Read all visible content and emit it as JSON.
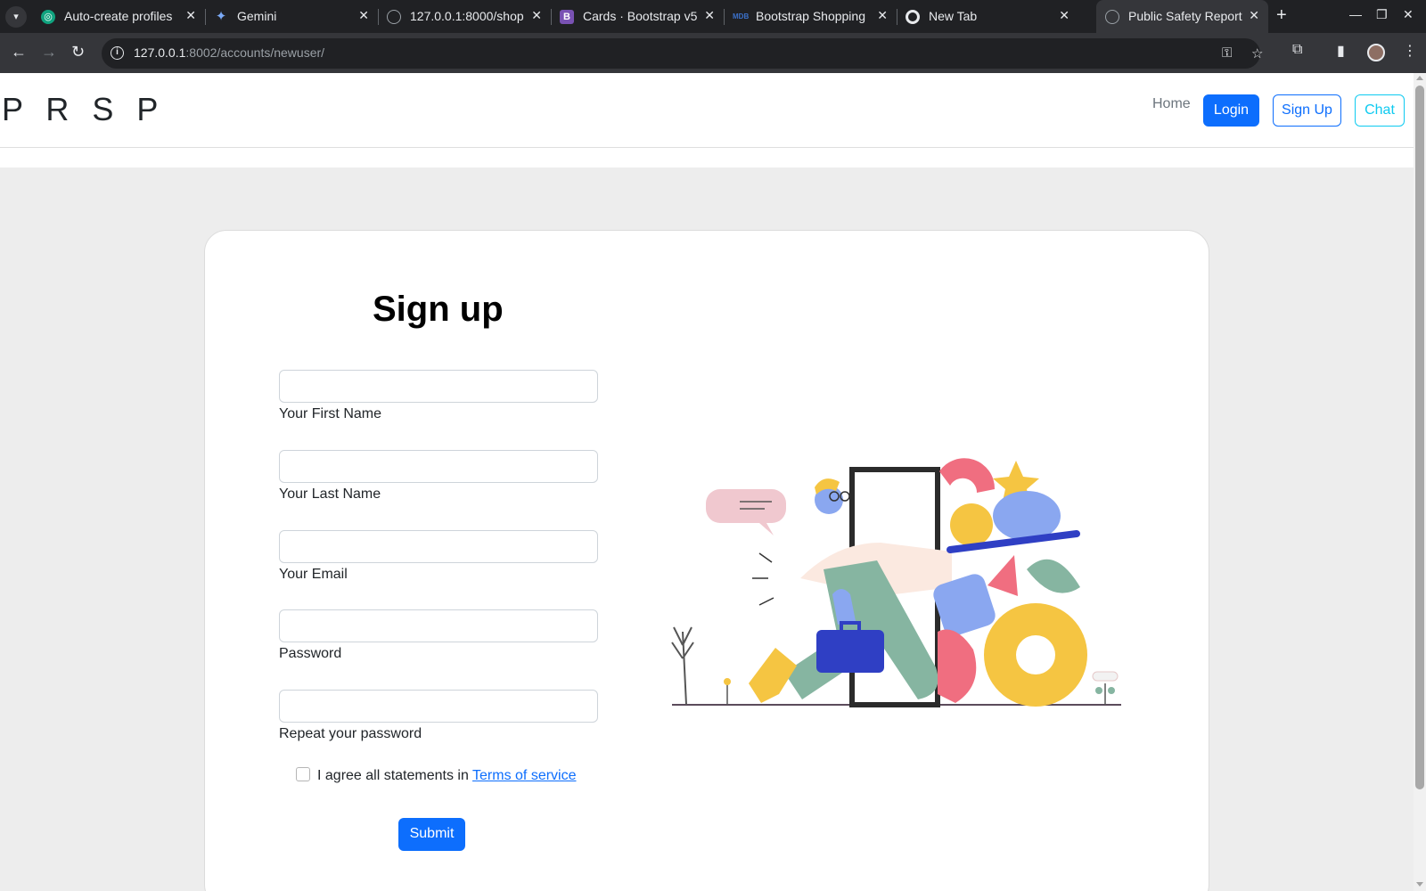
{
  "browser": {
    "tabs": [
      {
        "title": "Auto-create profiles",
        "favicon": "chatgpt-icon",
        "active": false
      },
      {
        "title": "Gemini",
        "favicon": "gemini-sparkle-icon",
        "active": false
      },
      {
        "title": "127.0.0.1:8000/shop",
        "favicon": "globe-icon",
        "active": false
      },
      {
        "title": "Cards · Bootstrap v5",
        "favicon": "bootstrap-icon",
        "active": false
      },
      {
        "title": "Bootstrap Shopping",
        "favicon": "mdb-icon",
        "active": false
      },
      {
        "title": "New Tab",
        "favicon": "chrome-icon",
        "active": false
      },
      {
        "title": "Public Safety Report",
        "favicon": "globe-icon",
        "active": true
      }
    ],
    "url_host": "127.0.0.1",
    "url_path": ":8002/accounts/newuser/"
  },
  "nav": {
    "brand": "P R S P",
    "home": "Home",
    "login": "Login",
    "signup": "Sign Up",
    "chat": "Chat"
  },
  "form": {
    "title": "Sign up",
    "fields": [
      {
        "label": "Your First Name",
        "value": ""
      },
      {
        "label": "Your Last Name",
        "value": ""
      },
      {
        "label": "Your Email",
        "value": ""
      },
      {
        "label": "Password",
        "value": ""
      },
      {
        "label": "Repeat your password",
        "value": ""
      }
    ],
    "agree_text": "I agree all statements in ",
    "terms_link": "Terms of service",
    "submit": "Submit"
  },
  "colors": {
    "primary": "#0d6efd",
    "info": "#0dcaf0",
    "page_bg": "#ededed"
  }
}
